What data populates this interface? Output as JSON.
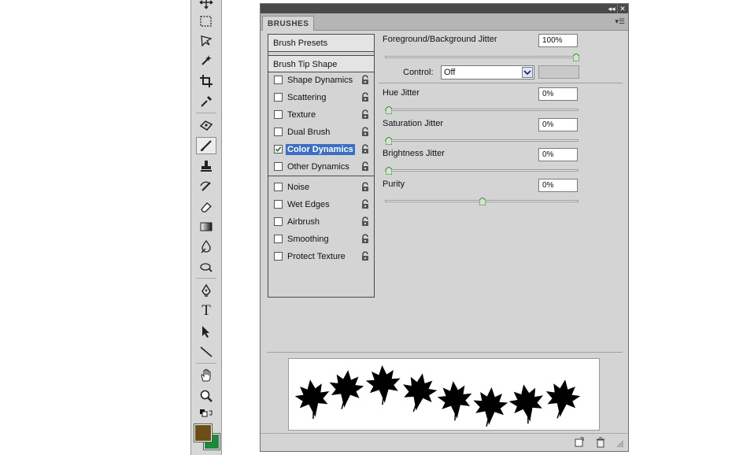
{
  "panel": {
    "tab_label": "BRUSHES",
    "titlebar": {
      "collapse_glyph": "◂◂",
      "close_glyph": "✕"
    },
    "menu_glyph": "▾☰",
    "list": {
      "presets_label": "Brush Presets",
      "tip_shape_label": "Brush Tip Shape",
      "items": [
        {
          "label": "Shape Dynamics",
          "checked": false
        },
        {
          "label": "Scattering",
          "checked": false
        },
        {
          "label": "Texture",
          "checked": false
        },
        {
          "label": "Dual Brush",
          "checked": false
        },
        {
          "label": "Color Dynamics",
          "checked": true
        },
        {
          "label": "Other Dynamics",
          "checked": false
        },
        {
          "label": "Noise",
          "checked": false
        },
        {
          "label": "Wet Edges",
          "checked": false
        },
        {
          "label": "Airbrush",
          "checked": false
        },
        {
          "label": "Smoothing",
          "checked": false
        },
        {
          "label": "Protect Texture",
          "checked": false
        }
      ]
    },
    "settings": {
      "fg_bg_jitter": {
        "label": "Foreground/Background Jitter",
        "value": "100%",
        "slider_fraction": 1.0
      },
      "control": {
        "label": "Control:",
        "value": "Off"
      },
      "hue_jitter": {
        "label": "Hue Jitter",
        "value": "0%",
        "slider_fraction": 0.0
      },
      "saturation_jitter": {
        "label": "Saturation Jitter",
        "value": "0%",
        "slider_fraction": 0.0
      },
      "brightness_jitter": {
        "label": "Brightness Jitter",
        "value": "0%",
        "slider_fraction": 0.0
      },
      "purity": {
        "label": "Purity",
        "value": "0%",
        "slider_fraction": 0.5
      }
    }
  },
  "toolbar": {
    "tools": [
      "move-tool",
      "marquee-tool",
      "lasso-tool",
      "magic-wand-tool",
      "crop-tool",
      "eyedropper-tool",
      "healing-tool",
      "brush-tool",
      "clone-stamp-tool",
      "history-brush-tool",
      "eraser-tool",
      "gradient-tool",
      "blur-tool",
      "dodge-tool",
      "pen-tool",
      "type-tool",
      "path-selection-tool",
      "line-tool",
      "hand-tool",
      "zoom-tool"
    ],
    "type_tool_glyph": "T",
    "foreground_color": "#6b4e14",
    "background_color": "#1c8a3a"
  },
  "colors": {
    "selection": "#3a6fc5",
    "check_mark": "#1a7a2a"
  }
}
